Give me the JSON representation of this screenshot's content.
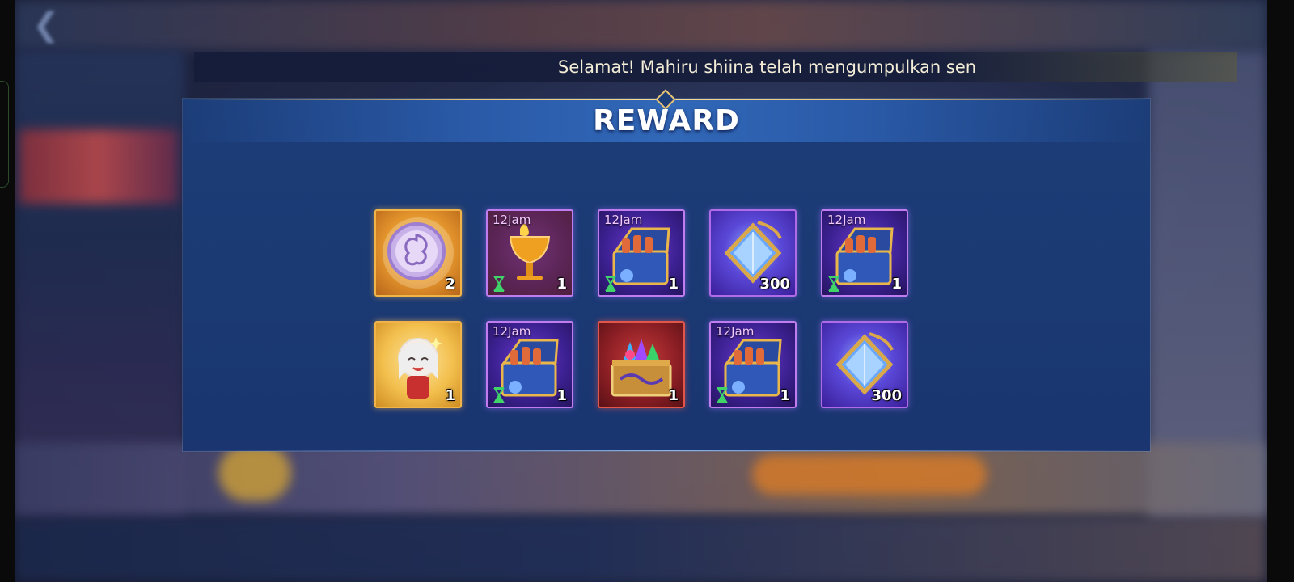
{
  "announcement": {
    "text": "Selamat! Mahiru shiina telah mengumpulkan sen"
  },
  "reward": {
    "title": "REWARD",
    "items": [
      {
        "name": "rose-emblem-coin",
        "frame": "gold",
        "quantity": "2",
        "timer": "",
        "timed": false
      },
      {
        "name": "golden-goblet-potion",
        "frame": "purple",
        "quantity": "1",
        "timer": "12Jam",
        "timed": true
      },
      {
        "name": "potion-chest",
        "frame": "purple",
        "quantity": "1",
        "timer": "12Jam",
        "timed": true
      },
      {
        "name": "blue-crystal-ticket",
        "frame": "purpleglow",
        "quantity": "300",
        "timer": "",
        "timed": false
      },
      {
        "name": "potion-chest",
        "frame": "purple",
        "quantity": "1",
        "timer": "12Jam",
        "timed": true
      },
      {
        "name": "chibi-character-sticker",
        "frame": "goldchar",
        "quantity": "1",
        "timer": "",
        "timed": false
      },
      {
        "name": "potion-chest",
        "frame": "purple",
        "quantity": "1",
        "timer": "12Jam",
        "timed": true
      },
      {
        "name": "gem-treasure-chest",
        "frame": "red",
        "quantity": "1",
        "timer": "",
        "timed": false
      },
      {
        "name": "potion-chest",
        "frame": "purple",
        "quantity": "1",
        "timer": "12Jam",
        "timed": true
      },
      {
        "name": "blue-crystal-ticket",
        "frame": "purpleglow",
        "quantity": "300",
        "timer": "",
        "timed": false
      }
    ]
  },
  "colors": {
    "panel": "#1c3d78",
    "accent_gold": "#e8c477",
    "timer_text": "#f3c8ff",
    "hourglass": "#3fd36a"
  }
}
